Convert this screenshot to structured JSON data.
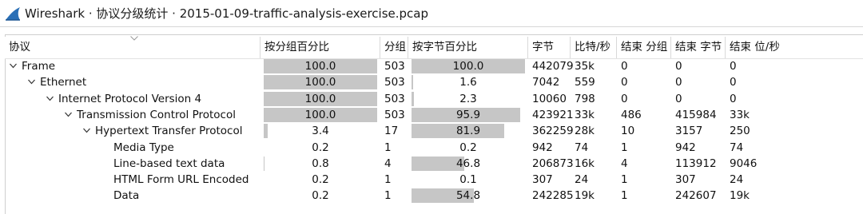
{
  "window": {
    "title": "Wireshark · 协议分级统计 · 2015-01-09-traffic-analysis-exercise.pcap",
    "icon": "wireshark-fin-icon"
  },
  "table": {
    "columns": [
      "协议",
      "按分组百分比",
      "分组",
      "按字节百分比",
      "字节",
      "比特/秒",
      "结束 分组",
      "结束 字节",
      "结束 位/秒"
    ],
    "sort_indicator": "chevron-down-icon",
    "rows": [
      {
        "protocol": "Frame",
        "level": 0,
        "expandable": true,
        "pct_packets": "100.0",
        "packets": "503",
        "pct_bytes": "100.0",
        "bytes": "442079",
        "bps": "35k",
        "end_packets": "0",
        "end_bytes": "0",
        "end_bps": "0"
      },
      {
        "protocol": "Ethernet",
        "level": 1,
        "expandable": true,
        "pct_packets": "100.0",
        "packets": "503",
        "pct_bytes": "1.6",
        "bytes": "7042",
        "bps": "559",
        "end_packets": "0",
        "end_bytes": "0",
        "end_bps": "0"
      },
      {
        "protocol": "Internet Protocol Version 4",
        "level": 2,
        "expandable": true,
        "pct_packets": "100.0",
        "packets": "503",
        "pct_bytes": "2.3",
        "bytes": "10060",
        "bps": "798",
        "end_packets": "0",
        "end_bytes": "0",
        "end_bps": "0"
      },
      {
        "protocol": "Transmission Control Protocol",
        "level": 3,
        "expandable": true,
        "pct_packets": "100.0",
        "packets": "503",
        "pct_bytes": "95.9",
        "bytes": "423921",
        "bps": "33k",
        "end_packets": "486",
        "end_bytes": "415984",
        "end_bps": "33k"
      },
      {
        "protocol": "Hypertext Transfer Protocol",
        "level": 4,
        "expandable": true,
        "pct_packets": "3.4",
        "packets": "17",
        "pct_bytes": "81.9",
        "bytes": "362259",
        "bps": "28k",
        "end_packets": "10",
        "end_bytes": "3157",
        "end_bps": "250"
      },
      {
        "protocol": "Media Type",
        "level": 5,
        "expandable": false,
        "pct_packets": "0.2",
        "packets": "1",
        "pct_bytes": "0.2",
        "bytes": "942",
        "bps": "74",
        "end_packets": "1",
        "end_bytes": "942",
        "end_bps": "74"
      },
      {
        "protocol": "Line-based text data",
        "level": 5,
        "expandable": false,
        "pct_packets": "0.8",
        "packets": "4",
        "pct_bytes": "46.8",
        "bytes": "206873",
        "bps": "16k",
        "end_packets": "4",
        "end_bytes": "113912",
        "end_bps": "9046"
      },
      {
        "protocol": "HTML Form URL Encoded",
        "level": 5,
        "expandable": false,
        "pct_packets": "0.2",
        "packets": "1",
        "pct_bytes": "0.1",
        "bytes": "307",
        "bps": "24",
        "end_packets": "1",
        "end_bytes": "307",
        "end_bps": "24"
      },
      {
        "protocol": "Data",
        "level": 5,
        "expandable": false,
        "pct_packets": "0.2",
        "packets": "1",
        "pct_bytes": "54.8",
        "bytes": "242285",
        "bps": "19k",
        "end_packets": "1",
        "end_bytes": "242607",
        "end_bps": "19k"
      }
    ]
  },
  "colors": {
    "bar_fill": "#c6c6c6",
    "icon_blue": "#2a6fb6",
    "grid_line": "#d9d9d9"
  }
}
